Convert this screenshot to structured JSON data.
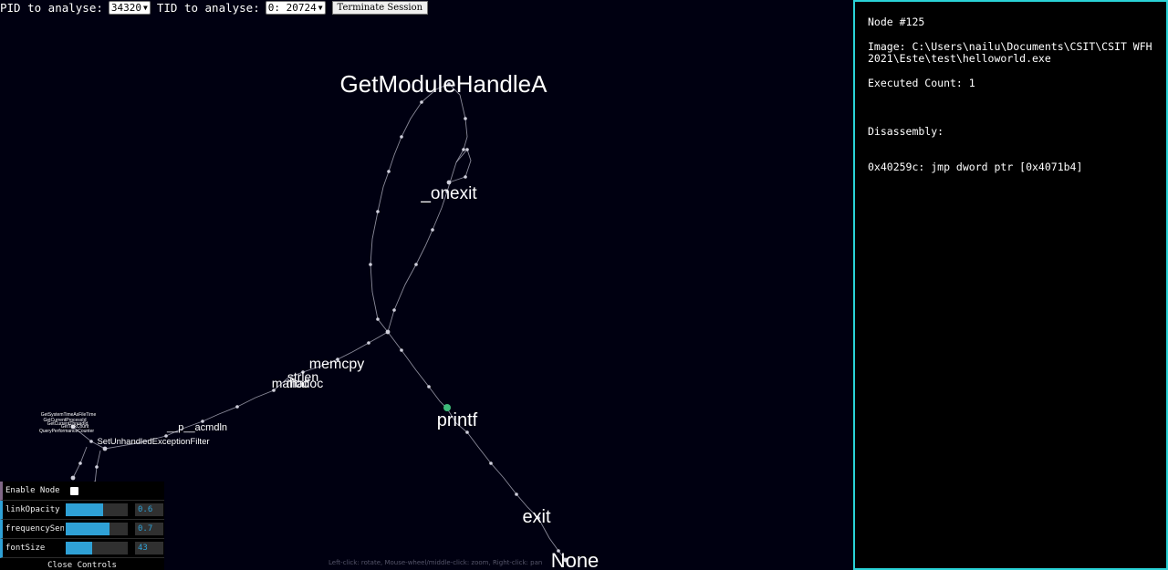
{
  "toolbar": {
    "pid_label": "PID to analyse:",
    "pid_value": "34320",
    "tid_label": "TID to analyse:",
    "tid_value": "0: 20724",
    "terminate_label": "Terminate Session"
  },
  "info_panel": {
    "node": "Node #125",
    "image": "Image: C:\\Users\\nailu\\Documents\\CSIT\\CSIT WFH 2021\\Este\\test\\helloworld.exe",
    "executed": "Executed Count: 1",
    "disassembly_label": "Disassembly:",
    "disassembly_line": "0x40259c: jmp dword ptr [0x4071b4]",
    "border_color": "#2ad3d7"
  },
  "graph": {
    "labels": {
      "getmodulehandlea": "GetModuleHandleA",
      "onexit": "_onexit",
      "memcpy": "memcpy",
      "strlen": "strlen",
      "malloc1": "malloc",
      "malloc2": "malloc",
      "p_acmdln": "__p__acmdln",
      "seh_filter": "SetUnhandledExceptionFilter",
      "printf": "printf",
      "exit": "exit",
      "none": "None",
      "cluster1": "GetSystemTimeAsFileTime",
      "cluster2": "GetCurrentProcessId",
      "cluster3": "GetCurrentThreadId",
      "cluster4": "GetTickCount",
      "cluster5": "QueryPerformanceCounter"
    },
    "highlight_color": "#3dbb7a",
    "link_color": "#b8b8c8",
    "node_color": "#d0d0dc"
  },
  "controls": {
    "enable_node_label": "Enable Node",
    "link_opacity_label": "linkOpacity",
    "link_opacity_value": "0.6",
    "link_opacity_level": 0.6,
    "frequency_label": "frequencySensi",
    "frequency_value": "0.7",
    "frequency_level": 0.7,
    "font_size_label": "fontSize",
    "font_size_value": "43",
    "font_size_level": 0.43,
    "close_label": "Close Controls",
    "accent": "#2fa1d6"
  },
  "hint": "Left-click: rotate, Mouse-wheel/middle-click: zoom, Right-click: pan"
}
